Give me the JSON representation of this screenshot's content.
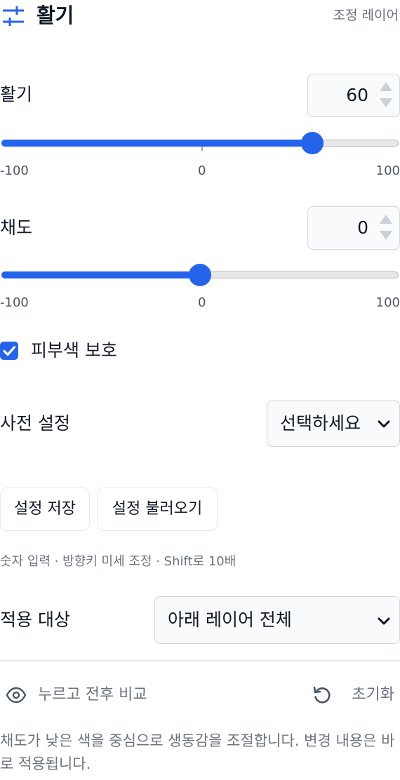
{
  "header": {
    "title": "활기",
    "tag": "조정 레이어",
    "icon": "sliders-icon"
  },
  "vibrance": {
    "label": "활기",
    "value": "60",
    "value_num": 60,
    "min": -100,
    "max": 100,
    "min_label": "-100",
    "mid_label": "0",
    "max_label": "100"
  },
  "saturation": {
    "label": "채도",
    "value": "0",
    "value_num": 0,
    "min": -100,
    "max": 100,
    "min_label": "-100",
    "mid_label": "0",
    "max_label": "100"
  },
  "skin_protect": {
    "label": "피부색 보호",
    "checked": true
  },
  "preset": {
    "label": "사전 설정",
    "selected": "선택하세요"
  },
  "buttons": {
    "save": "설정 저장",
    "load": "설정 불러오기"
  },
  "hint": "숫자 입력 · 방향키 미세 조정 · Shift로 10배",
  "apply_target": {
    "label": "적용 대상",
    "selected": "아래 레이어 전체"
  },
  "footer": {
    "compare": "누르고 전후 비교",
    "reset": "초기화"
  },
  "description": "채도가 낮은 색을 중심으로 생동감을 조절합니다. 변경 내용은 바로 적용됩니다.",
  "colors": {
    "accent": "#2563eb",
    "text": "#111827",
    "muted": "#6b7280",
    "border": "#d1d5db"
  }
}
